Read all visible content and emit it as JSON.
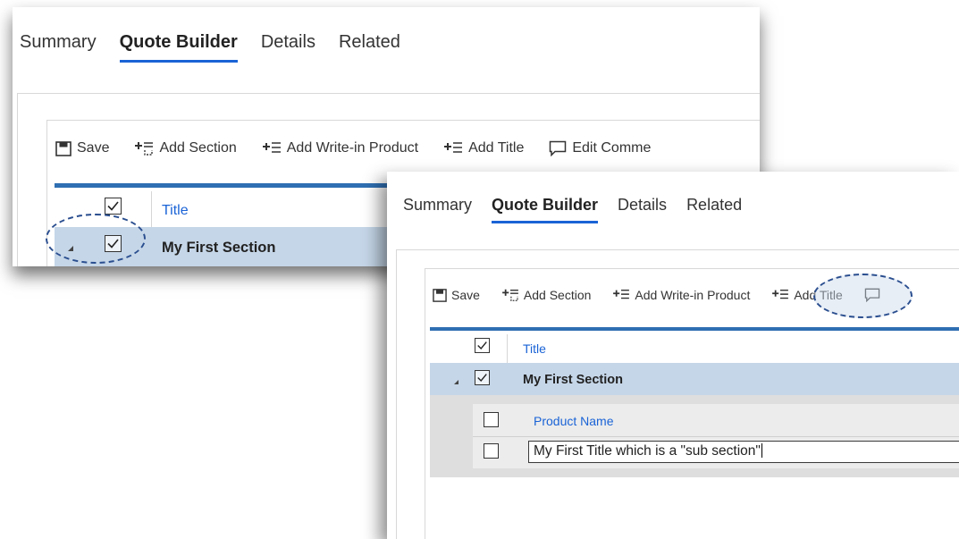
{
  "tabs": [
    "Summary",
    "Quote Builder",
    "Details",
    "Related"
  ],
  "toolbar": {
    "save": "Save",
    "add_section": "Add Section",
    "add_write_in_product": "Add Write-in Product",
    "add_title": "Add Title",
    "edit_comments": "Edit Comme"
  },
  "grid": {
    "title_column": "Title",
    "section_name": "My First Section",
    "product_name_column": "Product Name",
    "title_input_value": "My First Title which is a \"sub section\""
  },
  "colors": {
    "tab_underline": "#1a63d6",
    "header_bar": "#2f6fb2",
    "selected_row": "#c5d6e8",
    "column_header_text": "#1a63d6",
    "callout_border": "#2a4e8f"
  }
}
